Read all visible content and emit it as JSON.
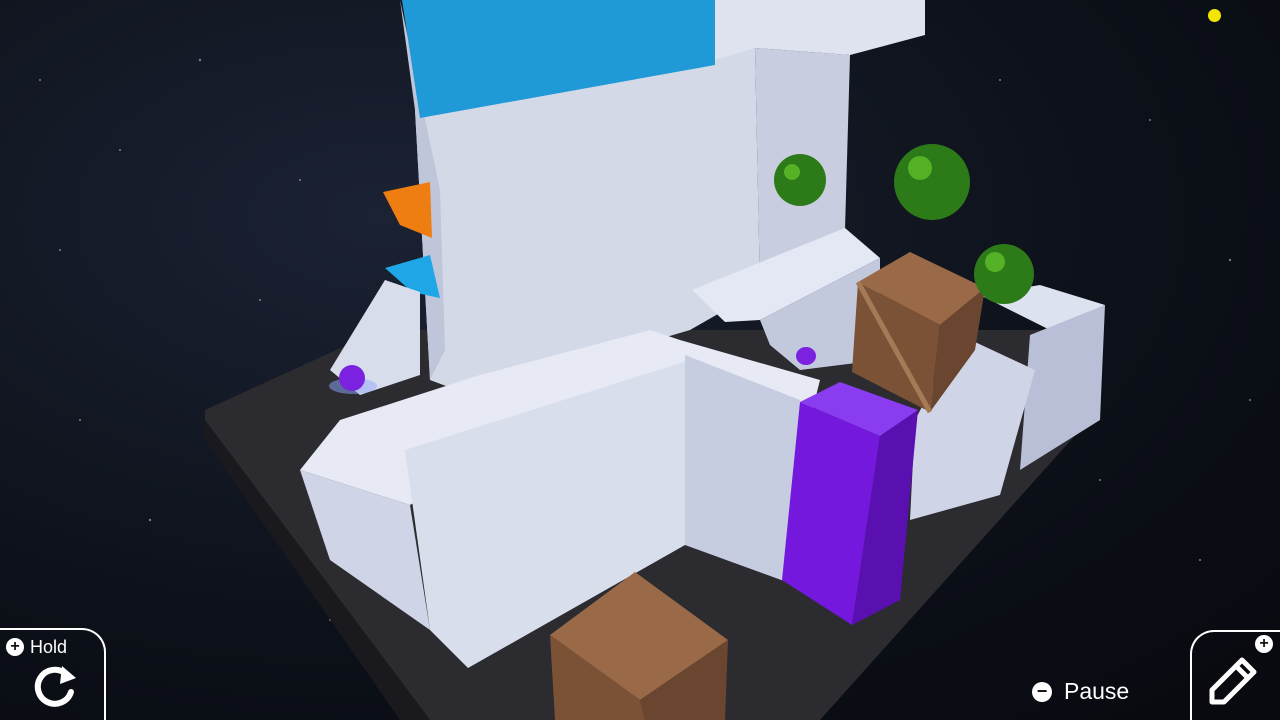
{
  "hud": {
    "hold_label": "Hold",
    "hold_badge": "+",
    "pause_label": "Pause",
    "pause_badge": "−",
    "edit_badge": "+"
  },
  "icons": {
    "hold_action": "rotate-icon",
    "edit_action": "pencil-icon"
  },
  "colors": {
    "space": "#0c1018",
    "wall": "#dfe3f0",
    "floor": "#2a2a2e",
    "purple_block": "#7a1ee0",
    "blue_block": "#1aa1e0",
    "orange_block": "#f08010",
    "crate": "#8a5a3a",
    "spiky_ball": "#3a8a1a",
    "orb": "#f2e600"
  }
}
